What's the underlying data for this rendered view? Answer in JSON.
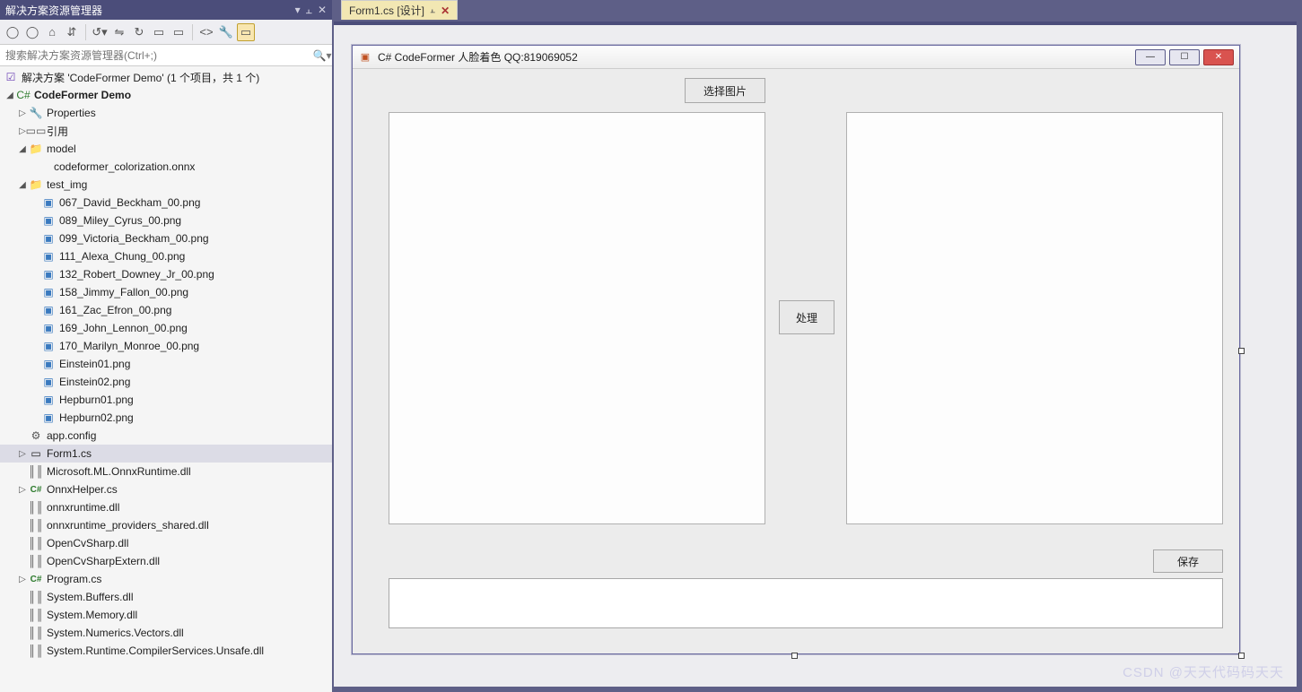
{
  "panel": {
    "title": "解决方案资源管理器",
    "dropdown_icon": "▾",
    "pin_icon": "📌",
    "close_icon": "✕"
  },
  "toolbar": {
    "buttons": [
      "⟲",
      "⟳",
      "🏠",
      "⇵",
      "⚙",
      "↺",
      "⇋",
      "↻",
      "▭",
      "▭",
      "❮❯",
      "<>",
      "🔧",
      "▭"
    ]
  },
  "search": {
    "placeholder": "搜索解决方案资源管理器(Ctrl+;)"
  },
  "tree": {
    "solution": "解决方案 'CodeFormer Demo' (1 个项目，共 1 个)",
    "project": "CodeFormer Demo",
    "properties": "Properties",
    "references": "引用",
    "model_folder": "model",
    "model_file": "codeformer_colorization.onnx",
    "test_img_folder": "test_img",
    "test_imgs": [
      "067_David_Beckham_00.png",
      "089_Miley_Cyrus_00.png",
      "099_Victoria_Beckham_00.png",
      "111_Alexa_Chung_00.png",
      "132_Robert_Downey_Jr_00.png",
      "158_Jimmy_Fallon_00.png",
      "161_Zac_Efron_00.png",
      "169_John_Lennon_00.png",
      "170_Marilyn_Monroe_00.png",
      "Einstein01.png",
      "Einstein02.png",
      "Hepburn01.png",
      "Hepburn02.png"
    ],
    "app_config": "app.config",
    "form1": "Form1.cs",
    "onnx_runtime_dll": "Microsoft.ML.OnnxRuntime.dll",
    "onnx_helper": "OnnxHelper.cs",
    "onnxruntime_dll": "onnxruntime.dll",
    "onnxruntime_providers": "onnxruntime_providers_shared.dll",
    "opencvsharp": "OpenCvSharp.dll",
    "opencvsharp_extern": "OpenCvSharpExtern.dll",
    "program_cs": "Program.cs",
    "sys_buffers": "System.Buffers.dll",
    "sys_memory": "System.Memory.dll",
    "sys_numerics": "System.Numerics.Vectors.dll",
    "sys_runtime": "System.Runtime.CompilerServices.Unsafe.dll"
  },
  "tab": {
    "label": "Form1.cs [设计]"
  },
  "form": {
    "title": "C# CodeFormer 人脸着色 QQ:819069052",
    "btn_select": "选择图片",
    "btn_process": "处理",
    "btn_save": "保存"
  },
  "watermark": "CSDN @天天代码码天天"
}
